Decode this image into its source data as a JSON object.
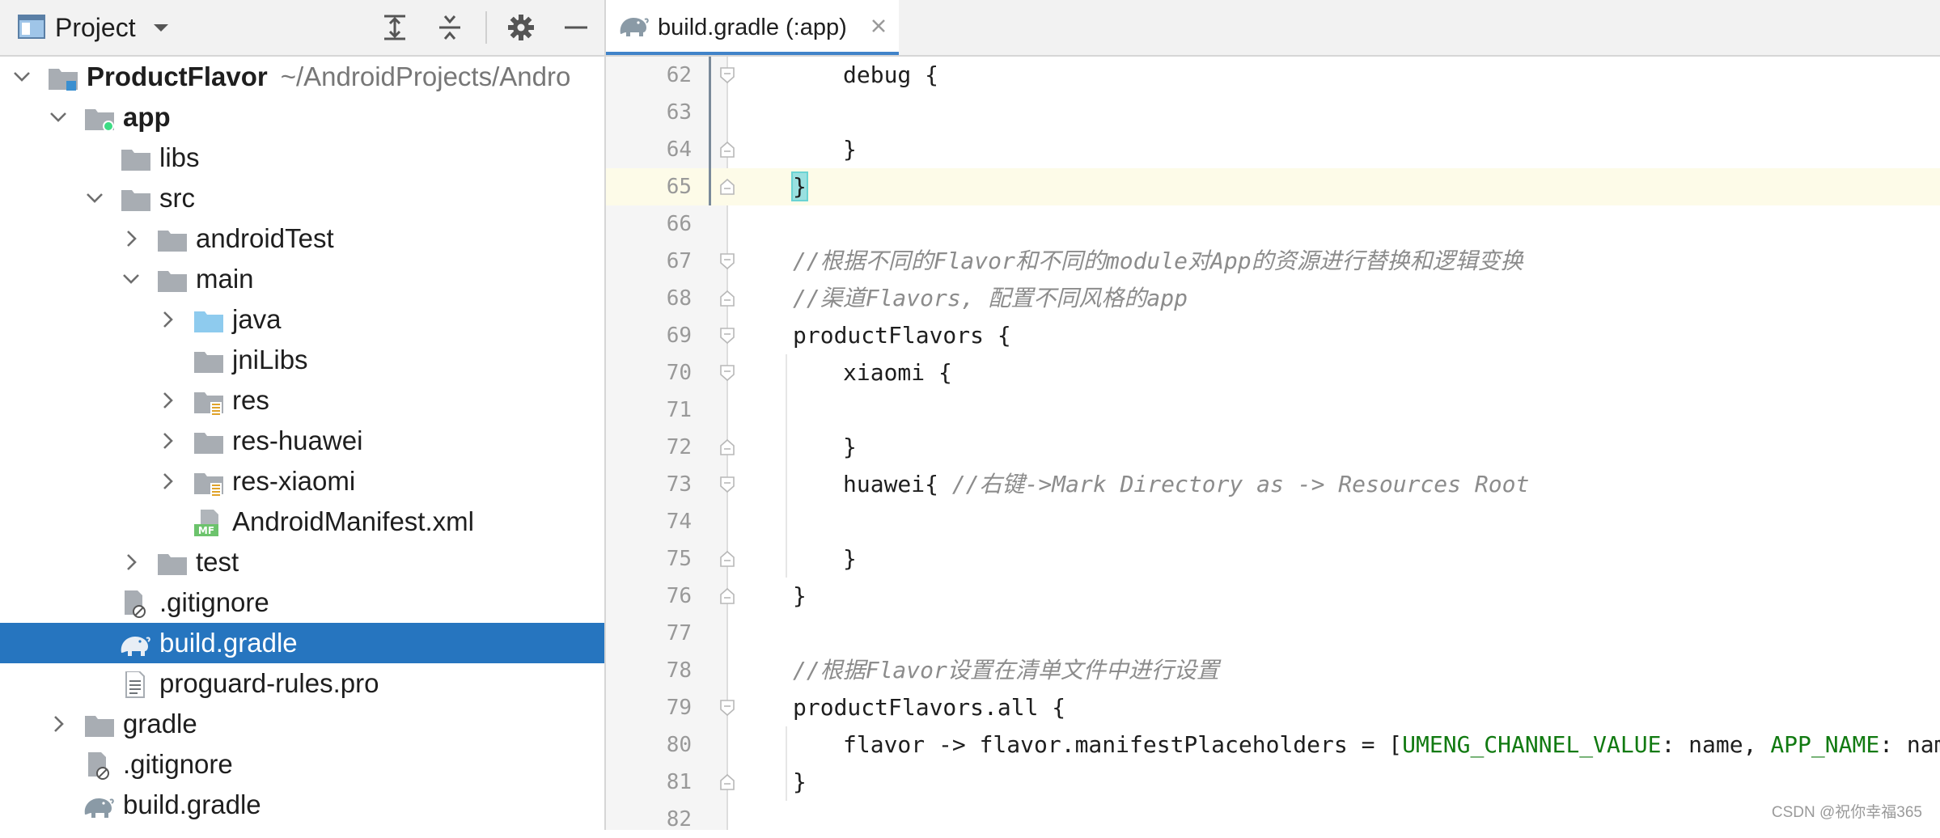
{
  "project_panel": {
    "title": "Project",
    "icons": [
      "project-view-icon",
      "dropdown-chevron-icon",
      "expand-all-icon",
      "collapse-all-icon",
      "settings-gear-icon",
      "minimize-icon"
    ],
    "tree": [
      {
        "label": "ProductFlavor",
        "path": "~/AndroidProjects/Andro",
        "bold": true,
        "depth": 0,
        "expander": "open",
        "icon": "module-folder-icon"
      },
      {
        "label": "app",
        "bold": true,
        "depth": 1,
        "expander": "open",
        "icon": "android-module-icon"
      },
      {
        "label": "libs",
        "depth": 2,
        "expander": "none",
        "icon": "folder-icon"
      },
      {
        "label": "src",
        "depth": 2,
        "expander": "open",
        "icon": "folder-icon"
      },
      {
        "label": "androidTest",
        "depth": 3,
        "expander": "closed",
        "icon": "folder-icon"
      },
      {
        "label": "main",
        "depth": 3,
        "expander": "open",
        "icon": "folder-icon"
      },
      {
        "label": "java",
        "depth": 4,
        "expander": "closed",
        "icon": "source-folder-icon"
      },
      {
        "label": "jniLibs",
        "depth": 4,
        "expander": "none",
        "icon": "folder-icon"
      },
      {
        "label": "res",
        "depth": 4,
        "expander": "closed",
        "icon": "resource-folder-icon"
      },
      {
        "label": "res-huawei",
        "depth": 4,
        "expander": "closed",
        "icon": "folder-icon"
      },
      {
        "label": "res-xiaomi",
        "depth": 4,
        "expander": "closed",
        "icon": "resource-folder-icon"
      },
      {
        "label": "AndroidManifest.xml",
        "depth": 4,
        "expander": "none",
        "icon": "manifest-file-icon",
        "badge": "MF"
      },
      {
        "label": "test",
        "depth": 3,
        "expander": "closed",
        "icon": "folder-icon"
      },
      {
        "label": ".gitignore",
        "depth": 2,
        "expander": "none",
        "icon": "ignore-file-icon"
      },
      {
        "label": "build.gradle",
        "depth": 2,
        "expander": "none",
        "icon": "gradle-elephant-icon",
        "selected": true
      },
      {
        "label": "proguard-rules.pro",
        "depth": 2,
        "expander": "none",
        "icon": "text-file-icon"
      },
      {
        "label": "gradle",
        "depth": 1,
        "expander": "closed",
        "icon": "folder-icon"
      },
      {
        "label": ".gitignore",
        "depth": 1,
        "expander": "none",
        "icon": "ignore-file-icon"
      },
      {
        "label": "build.gradle",
        "depth": 1,
        "expander": "none",
        "icon": "gradle-elephant-icon"
      }
    ]
  },
  "editor": {
    "tab": {
      "label": "build.gradle (:app)",
      "icon": "gradle-elephant-icon",
      "close_icon": "close-icon"
    },
    "current_line": 65,
    "lines": [
      {
        "num": "62",
        "indent": 1,
        "parts": [
          {
            "t": "debug {"
          }
        ],
        "fold": "top"
      },
      {
        "num": "63",
        "indent": 1,
        "parts": []
      },
      {
        "num": "64",
        "indent": 1,
        "parts": [
          {
            "t": "}"
          }
        ],
        "fold": "bottom"
      },
      {
        "num": "65",
        "indent": 0,
        "parts": [
          {
            "t": "}",
            "c": "brace-hl"
          }
        ],
        "fold": "bottom"
      },
      {
        "num": "66",
        "indent": 0,
        "parts": []
      },
      {
        "num": "67",
        "indent": 0,
        "parts": [
          {
            "t": "//根据不同的Flavor和不同的module对App的资源进行替换和逻辑变换",
            "c": "cm"
          }
        ],
        "fold": "top"
      },
      {
        "num": "68",
        "indent": 0,
        "parts": [
          {
            "t": "//渠道Flavors, 配置不同风格的app",
            "c": "cm"
          }
        ],
        "fold": "bottom"
      },
      {
        "num": "69",
        "indent": 0,
        "parts": [
          {
            "t": "productFlavors {"
          }
        ],
        "fold": "top"
      },
      {
        "num": "70",
        "indent": 1,
        "parts": [
          {
            "t": "xiaomi {"
          }
        ],
        "fold": "top"
      },
      {
        "num": "71",
        "indent": 1,
        "parts": []
      },
      {
        "num": "72",
        "indent": 1,
        "parts": [
          {
            "t": "}"
          }
        ],
        "fold": "bottom"
      },
      {
        "num": "73",
        "indent": 1,
        "parts": [
          {
            "t": "huawei{ "
          },
          {
            "t": "//右键->Mark Directory as -> Resources Root",
            "c": "cm"
          }
        ],
        "fold": "top"
      },
      {
        "num": "74",
        "indent": 1,
        "parts": []
      },
      {
        "num": "75",
        "indent": 1,
        "parts": [
          {
            "t": "}"
          }
        ],
        "fold": "bottom"
      },
      {
        "num": "76",
        "indent": 0,
        "parts": [
          {
            "t": "}"
          }
        ],
        "fold": "bottom"
      },
      {
        "num": "77",
        "indent": 0,
        "parts": []
      },
      {
        "num": "78",
        "indent": 0,
        "parts": [
          {
            "t": "//根据Flavor设置在清单文件中进行设置",
            "c": "cm"
          }
        ]
      },
      {
        "num": "79",
        "indent": 0,
        "parts": [
          {
            "t": "productFlavors.all {"
          }
        ],
        "fold": "top"
      },
      {
        "num": "80",
        "indent": 1,
        "parts": [
          {
            "t": "flavor -> flavor.manifestPlaceholders = ["
          },
          {
            "t": "UMENG_CHANNEL_VALUE",
            "c": "key"
          },
          {
            "t": ": name, "
          },
          {
            "t": "APP_NAME",
            "c": "key"
          },
          {
            "t": ": name]"
          }
        ]
      },
      {
        "num": "81",
        "indent": 0,
        "parts": [
          {
            "t": "}"
          }
        ],
        "fold": "bottom"
      },
      {
        "num": "82",
        "indent": 0,
        "parts": []
      }
    ]
  },
  "colors": {
    "selection": "#2675bf",
    "comment": "#8c8c8c",
    "map_key": "#117a11",
    "brace_highlight": "#99e0e0",
    "current_line": "#fdfbe8"
  },
  "watermark": "CSDN @祝你幸福365"
}
